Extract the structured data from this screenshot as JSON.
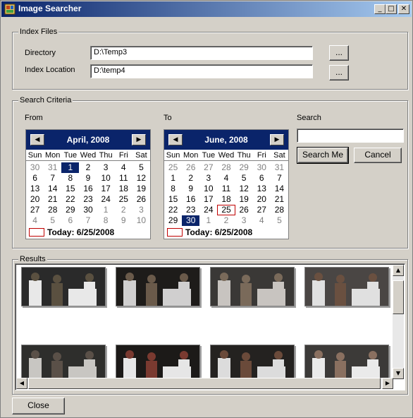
{
  "window": {
    "title": "Image Searcher",
    "minimize_glyph": "_",
    "maximize_glyph": "□",
    "close_glyph": "✕"
  },
  "index_files": {
    "group_label": "Index Files",
    "directory_label": "Directory",
    "directory_value": "D:\\Temp3",
    "index_location_label": "Index Location",
    "index_location_value": "D:\\temp4",
    "browse_label": "..."
  },
  "search_criteria": {
    "group_label": "Search Criteria",
    "from_label": "From",
    "to_label": "To",
    "search_label": "Search",
    "search_value": "",
    "search_button": "Search Me",
    "cancel_button": "Cancel"
  },
  "calendars": {
    "dow": [
      "Sun",
      "Mon",
      "Tue",
      "Wed",
      "Thu",
      "Fri",
      "Sat"
    ],
    "prev_glyph": "◀",
    "next_glyph": "▶",
    "from": {
      "month_title": "April, 2008",
      "today_text": "Today: 6/25/2008",
      "days": [
        30,
        31,
        1,
        2,
        3,
        4,
        5,
        6,
        7,
        8,
        9,
        10,
        11,
        12,
        13,
        14,
        15,
        16,
        17,
        18,
        19,
        20,
        21,
        22,
        23,
        24,
        25,
        26,
        27,
        28,
        29,
        30,
        1,
        2,
        3,
        4,
        5,
        6,
        7,
        8,
        9,
        10
      ],
      "current_month_range": [
        2,
        31
      ],
      "selected_index": 2,
      "today_index": -1
    },
    "to": {
      "month_title": "June, 2008",
      "today_text": "Today: 6/25/2008",
      "days": [
        25,
        26,
        27,
        28,
        29,
        30,
        31,
        1,
        2,
        3,
        4,
        5,
        6,
        7,
        8,
        9,
        10,
        11,
        12,
        13,
        14,
        15,
        16,
        17,
        18,
        19,
        20,
        21,
        22,
        23,
        24,
        25,
        26,
        27,
        28,
        29,
        30,
        1,
        2,
        3,
        4,
        5
      ],
      "current_month_range": [
        7,
        36
      ],
      "selected_index": 36,
      "today_index": 31
    }
  },
  "results": {
    "group_label": "Results",
    "thumbnails": [
      {
        "name": "photo-1",
        "colors": [
          "#2a2a2a",
          "#e8e8e8",
          "#5a5040"
        ]
      },
      {
        "name": "photo-2",
        "colors": [
          "#1e1c1a",
          "#d0cfcf",
          "#6a5a4a"
        ]
      },
      {
        "name": "photo-3",
        "colors": [
          "#3a3836",
          "#c8c4c0",
          "#7a6a5a"
        ]
      },
      {
        "name": "photo-4",
        "colors": [
          "#4a4644",
          "#e0e0e0",
          "#6a5040"
        ]
      },
      {
        "name": "photo-5",
        "colors": [
          "#2e2e2c",
          "#c8c6c2",
          "#5a5048"
        ]
      },
      {
        "name": "photo-6",
        "colors": [
          "#1c1a18",
          "#e6e6e6",
          "#7a3a30"
        ]
      },
      {
        "name": "photo-7",
        "colors": [
          "#242220",
          "#dcdcdc",
          "#6a4a3a"
        ]
      },
      {
        "name": "photo-8",
        "colors": [
          "#3c3a38",
          "#eaeaea",
          "#8a7060"
        ]
      }
    ],
    "scroll_up": "▲",
    "scroll_down": "▼",
    "scroll_left": "◀",
    "scroll_right": "▶"
  },
  "footer": {
    "close_button": "Close"
  }
}
